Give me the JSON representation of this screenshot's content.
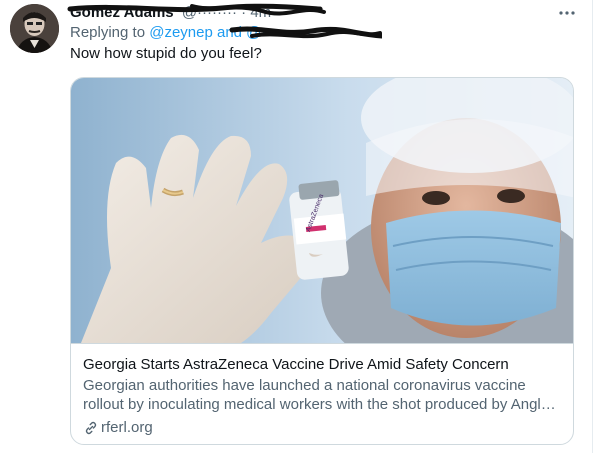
{
  "tweet": {
    "author_name": "Gomez Adams",
    "handle_and_time": "@········ · 4m",
    "replying_prefix": "Replying to",
    "replying_mentions": "@zeynep and @··········",
    "text": "Now how stupid do you feel?",
    "more_icon": "more-horizontal-icon"
  },
  "card": {
    "title": "Georgia Starts AstraZeneca Vaccine Drive Amid Safety Concern",
    "description": "Georgian authorities have launched a national coronavirus vaccine rollout by inoculating medical workers with the shot produced by Anglo-Swedish drugmaker AstraZeneca.",
    "source": "rferl.org",
    "source_icon": "link-icon",
    "vial_label": "AstraZeneca"
  },
  "colors": {
    "accent": "#1d9bf0",
    "secondary_text": "#536471",
    "border": "#cfd9de"
  }
}
